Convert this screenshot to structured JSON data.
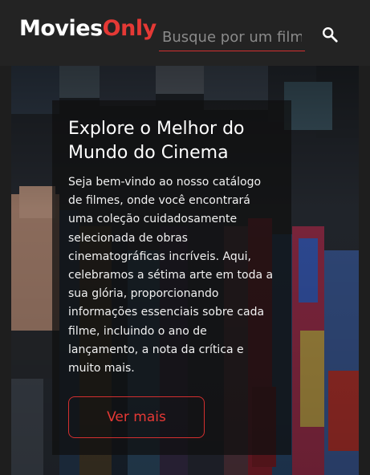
{
  "header": {
    "logo_part1": "Movies",
    "logo_part2": "Only",
    "search_placeholder": "Busque por um filme",
    "search_icon": "search-icon"
  },
  "hero": {
    "background": "vhs-tapes-shelf-photo",
    "title": "Explore o Melhor do Mundo do Cinema",
    "text": "Seja bem-vindo ao nosso catálogo de filmes, onde você encontrará uma coleção cuidadosamente selecionada de obras cinematográficas incríveis. Aqui, celebramos a sétima arte em toda a sua glória, proporcionando informações essenciais sobre cada filme, incluindo o ano de lançamento, a nota da crítica e muito mais.",
    "button_label": "Ver mais"
  },
  "colors": {
    "accent": "#e53935",
    "header_bg": "#232323",
    "page_bg": "#1e1e1e"
  }
}
